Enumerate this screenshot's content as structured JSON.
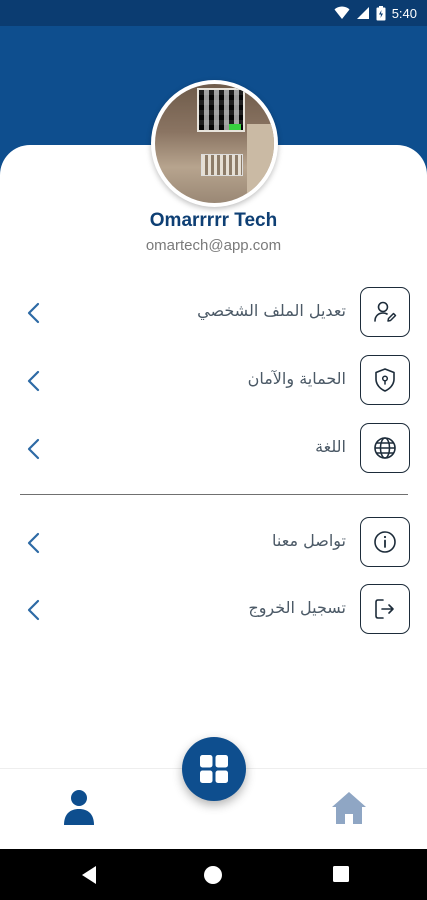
{
  "status_bar": {
    "time": "5:40"
  },
  "profile": {
    "name": "Omarrrrr Tech",
    "email": "omartech@app.com"
  },
  "menu": {
    "items": [
      {
        "label": "تعديل الملف الشخصي",
        "icon": "edit-user-icon"
      },
      {
        "label": "الحماية والآمان",
        "icon": "shield-icon"
      },
      {
        "label": "اللغة",
        "icon": "globe-icon"
      },
      {
        "label": "تواصل معنا",
        "icon": "info-icon"
      },
      {
        "label": "تسجيل الخروج",
        "icon": "logout-icon"
      }
    ]
  },
  "bottom_nav": {
    "items": [
      "profile-icon",
      "grid-icon",
      "home-icon"
    ]
  },
  "colors": {
    "primary": "#0e4e8e",
    "status_bar": "#0b3c71",
    "name_text": "#0e3f74",
    "chevron": "#2d6aa5",
    "home_inactive": "#8fa6c4"
  }
}
